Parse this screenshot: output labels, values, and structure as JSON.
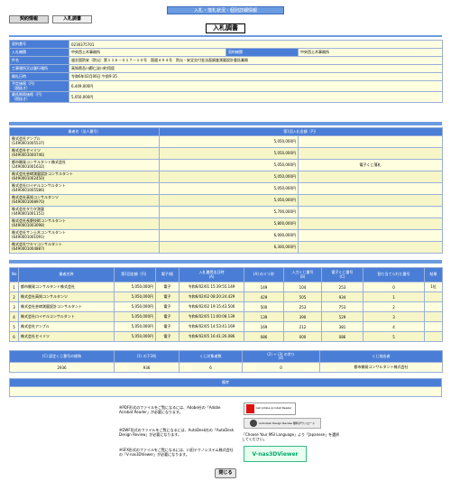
{
  "header": {
    "banner": "入札・落札状況・個別詳細情報",
    "tabs": [
      "契約情報",
      "入札調書"
    ],
    "page_title": "入札調書"
  },
  "info": [
    {
      "label": "契約番号",
      "value": "0230375701"
    },
    {
      "label": "入札機関",
      "value": "中央西土木事務所",
      "label2": "契約機関",
      "value2": "中央西土木事務所"
    },
    {
      "label": "件名",
      "value": "道交国防安（防災）第１１６－０１７－１０号　国道４９４号　防災・安全交付金法面調査測量設計委託業務"
    },
    {
      "label": "工事場所又は履行場所",
      "value": "高知県吾川郡仁淀川町用居"
    },
    {
      "label": "開札日時",
      "value": "令和6年02月06日 午前9:35"
    },
    {
      "label": "予定価格（円）\n（税抜き）",
      "value": "6,449,000円"
    },
    {
      "label": "最低制限価格（円）\n（税抜き）",
      "value": "5,050,000円"
    }
  ],
  "bidders_table": {
    "headers": [
      "業者名（法人番号）",
      "第1回入札金額（円）",
      ""
    ],
    "rows": [
      {
        "name": "株式会社アンプル",
        "num": "(1490001005537)",
        "amount": "5,050,000円",
        "note": ""
      },
      {
        "name": "株式会社セイミツ",
        "num": "(6490001000746)",
        "amount": "5,050,000円",
        "note": ""
      },
      {
        "name": "都市開発コンサルタント株式会社",
        "num": "(2490001001632)",
        "amount": "5,050,000円",
        "note": "電子くじ落札"
      },
      {
        "name": "株式会社芸﨑測量設計コンサルタント",
        "num": "(6490001002450)",
        "amount": "5,050,000円",
        "note": ""
      },
      {
        "name": "株式会社ロイヤルコンサルタント",
        "num": "(6490001005586)",
        "amount": "5,050,000円",
        "note": ""
      },
      {
        "name": "株式会社高知コンサルタンツ",
        "num": "(6490001008970)",
        "amount": "5,050,000円",
        "note": ""
      },
      {
        "name": "株式会社タカタ測量",
        "num": "(4490001001151)",
        "amount": "5,700,000円",
        "note": ""
      },
      {
        "name": "株式会社長野技術コンサルタント",
        "num": "(6490001003098)",
        "amount": "5,800,000円",
        "note": ""
      },
      {
        "name": "株式会社サン土木コンサルタント",
        "num": "(6490001001091)",
        "amount": "6,000,000円",
        "note": ""
      },
      {
        "name": "株式会社ワキリコンサルタント",
        "num": "(6490001004887)",
        "amount": "6,300,000円",
        "note": ""
      }
    ]
  },
  "lottery_table": {
    "headers": [
      "No",
      "業者名称",
      "第1回金額（円）",
      "電子/紙",
      "入札書提出日時\n(A)",
      "(A) のミリ秒",
      "入力くじ番号\n(B)",
      "電子くじ番号\n(C)",
      "割り当てられた番号",
      "結果"
    ],
    "rows": [
      [
        "1",
        "都市開発コンサルタント株式会社",
        "5,050,000円",
        "電子",
        "令和6/02/01 15:39:55.149",
        "149",
        "104",
        "253",
        "0",
        "1位"
      ],
      [
        "2",
        "株式会社高知コンサルタンツ",
        "5,050,000円",
        "電子",
        "令和6/02/02 08:20:24.429",
        "429",
        "505",
        "934",
        "1",
        ""
      ],
      [
        "3",
        "株式会社芸﨑測量設計コンサルタント",
        "5,050,000円",
        "電子",
        "令和6/02/02 19:15:43.500",
        "500",
        "253",
        "753",
        "2",
        ""
      ],
      [
        "4",
        "株式会社ロイヤルコンサルタント",
        "5,050,000円",
        "電子",
        "令和6/02/05 11:00:08.139",
        "139",
        "390",
        "529",
        "3",
        ""
      ],
      [
        "5",
        "株式会社アンプル",
        "5,050,000円",
        "電子",
        "令和6/02/05 14:53:41.169",
        "169",
        "212",
        "381",
        "4",
        ""
      ],
      [
        "6",
        "株式会社セイミツ",
        "5,050,000円",
        "電子",
        "令和6/02/05 16:41:26.086",
        "086",
        "000",
        "086",
        "5",
        ""
      ]
    ]
  },
  "summary_table": {
    "headers": [
      "(C) 認定くじ番号の総和",
      "(1) の下3桁",
      "くじ対象者数",
      "(2) ÷ (3) の余り\n(4)",
      "くじ抽出者"
    ],
    "values": [
      "2936",
      "936",
      "6",
      "0",
      "都市開発コンサルタント株式会社"
    ]
  },
  "remarks": {
    "label": "備考",
    "value": ""
  },
  "notes": {
    "pdf": "※PDF形式のファイルをご覧になるには、Adobe社の「Adobe Acrobat Reader」が必要になります。",
    "dwf": "※DWF形式のファイルをご覧になるには、AutoDesk社の「AutoDesk Design Review」が必要になります。",
    "sfx": "※SFX形式のファイルをご覧になるには、川田テクノシステム株式会社の「V-nas3DViewer」が必要になります。",
    "lang": "「Choose Your MSI Language」より「Japanese」を選択してください。"
  },
  "badges": {
    "adobe": "Get Adobe Acrobat Reader",
    "autodesk": "Autodesk Design Review 無料ダウンロード",
    "vnas": "V-nas3DViewer"
  },
  "close_label": "閉じる"
}
